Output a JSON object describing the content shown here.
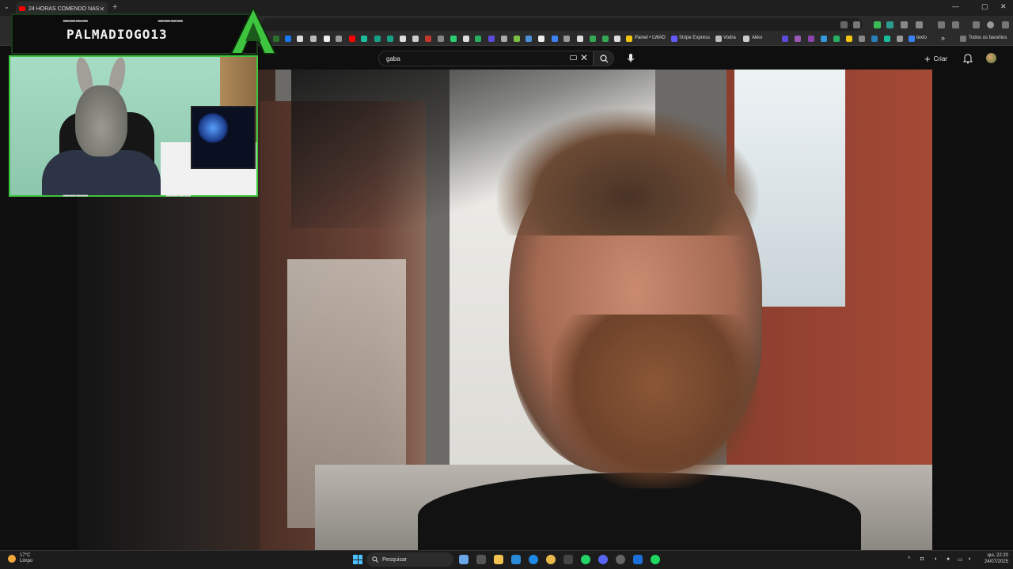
{
  "browser": {
    "tab_title": "24 HORAS COMENDO NAS",
    "tab_close": "✕",
    "new_tab": "+",
    "window_controls": [
      "—",
      "▢",
      "✕"
    ],
    "bookmarks": {
      "painel": "Painel • LWAD",
      "stripe": "Stripe Express",
      "vodra": "Vodra",
      "akko": "Akko",
      "texto": "texto",
      "more": "»",
      "all_favorites": "Todos os favoritos"
    }
  },
  "youtube": {
    "search": {
      "query": "gaba"
    },
    "create_label": "Criar",
    "icons": [
      "keyboard-icon",
      "clear-icon",
      "search-icon",
      "mic-icon",
      "bell-icon"
    ]
  },
  "overlay": {
    "streamer_name": "PALMADIOGO13",
    "dashes": "▁▁▁▁"
  },
  "taskbar": {
    "weather_temp": "17°C",
    "weather_cond": "Limpo",
    "search_label": "Pesquisar",
    "time": "qui, 22:20",
    "date": "24/07/2025"
  },
  "colors": {
    "overlay_green": "#3ec43e",
    "youtube_red": "#ff0000",
    "windows_accent": "#4cc2ff"
  }
}
